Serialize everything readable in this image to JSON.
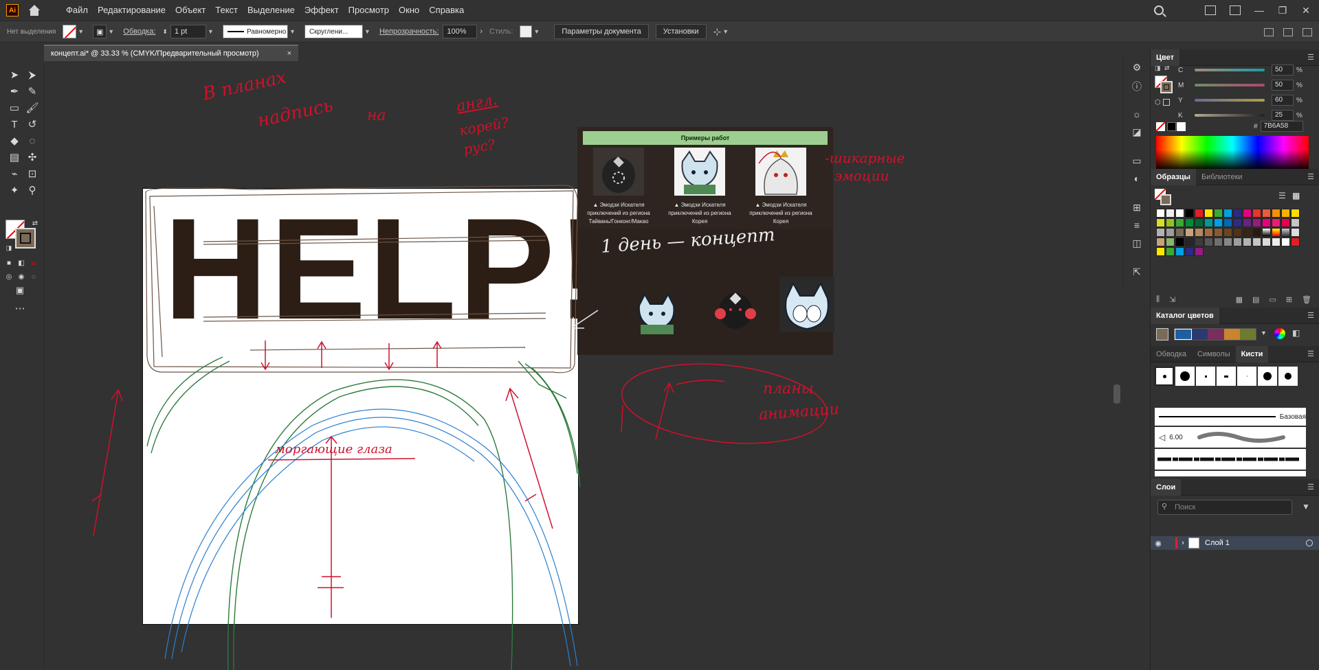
{
  "app": {
    "logo": "Ai",
    "menu": [
      "Файл",
      "Редактирование",
      "Объект",
      "Текст",
      "Выделение",
      "Эффект",
      "Просмотр",
      "Окно",
      "Справка"
    ]
  },
  "control_bar": {
    "selection": "Нет выделения",
    "stroke_label": "Обводка:",
    "stroke_value": "1 pt",
    "stroke_type": "Равномерно",
    "brush": "Скруглени...",
    "opacity_label": "Непрозрачность:",
    "opacity_value": "100%",
    "style_label": "Стиль:",
    "doc_params": "Параметры документа",
    "settings": "Установки"
  },
  "document": {
    "tab_title": "концепт.ai* @ 33.33 % (CMYK/Предварительный просмотр)",
    "close": "×"
  },
  "artboard": {
    "headline": "HELP!"
  },
  "reference": {
    "header": "Примеры работ",
    "items": [
      {
        "line1": "▲ Эмодзи Искателя",
        "line2": "приключений из региона",
        "line3": "Тайвань/Гонконг/Макао"
      },
      {
        "line1": "▲ Эмодзи Искателя",
        "line2": "приключений из региона",
        "line3": "Корея"
      },
      {
        "line1": "▲ Эмодзи Искателя",
        "line2": "приключений из региона",
        "line3": "Корея"
      }
    ]
  },
  "annotations": {
    "top_note_1": "В планах",
    "top_note_2": "надпись",
    "top_note_3": "на",
    "top_note_4": "англ.",
    "top_note_5": "корей?",
    "top_note_6": "рус?",
    "side_note_1": "-шикарные",
    "side_note_2": "эмоции",
    "day_note": "1 день — концепт",
    "plans_1": "планы",
    "plans_2": "анимации",
    "eyes": "моргающие глаза"
  },
  "color_panel": {
    "title": "Цвет",
    "channels": [
      {
        "label": "C",
        "value": "50",
        "unit": "%"
      },
      {
        "label": "M",
        "value": "50",
        "unit": "%"
      },
      {
        "label": "Y",
        "value": "60",
        "unit": "%"
      },
      {
        "label": "K",
        "value": "25",
        "unit": "%"
      }
    ],
    "hex_prefix": "#",
    "hex": "7B6A58"
  },
  "swatches_panel": {
    "tabs": [
      "Образцы",
      "Библиотеки"
    ]
  },
  "catalog_panel": {
    "title": "Каталог цветов"
  },
  "brushes_panel": {
    "tabs": [
      "Обводка",
      "Символы",
      "Кисти"
    ],
    "basic": "Базовая",
    "size": "6.00"
  },
  "layers_panel": {
    "title": "Слои",
    "search_placeholder": "Поиск",
    "layer_name": "Слой 1"
  },
  "colors": {
    "help": "#2c1e14",
    "accent_red": "#d0112b",
    "green": "#2b7a3a",
    "blue": "#2a7fd0",
    "fill": "#7b6a58"
  }
}
